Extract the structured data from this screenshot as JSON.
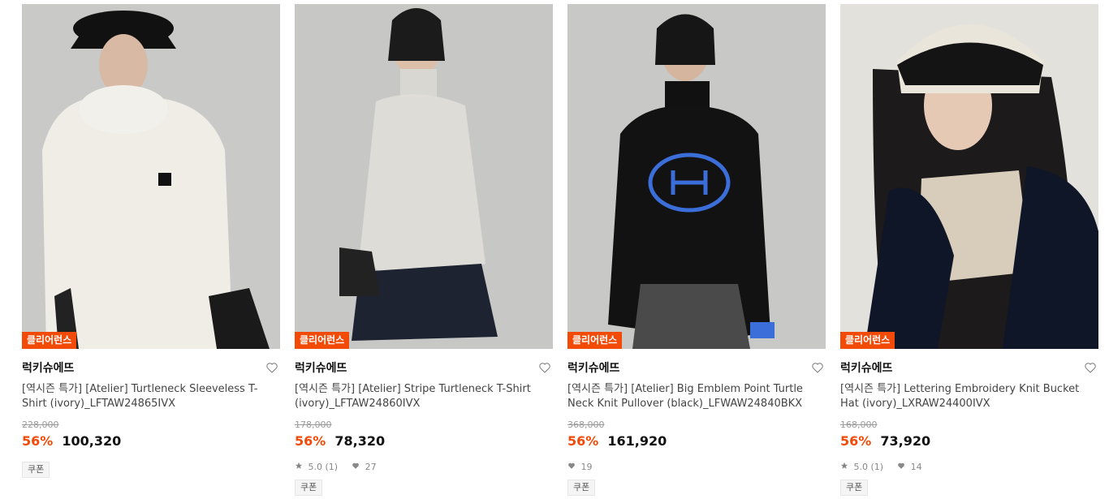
{
  "products": [
    {
      "tag": "클리어런스",
      "brand": "럭키슈에뜨",
      "title": "[역시즌 특가] [Atelier] Turtleneck Sleeveless T-Shirt (ivory)_LFTAW24865IVX",
      "original_price": "228,000",
      "discount_rate": "56%",
      "sale_price": "100,320",
      "rating": "",
      "likes": "",
      "coupon": "쿠폰"
    },
    {
      "tag": "클리어런스",
      "brand": "럭키슈에뜨",
      "title": "[역시즌 특가] [Atelier] Stripe Turtleneck T-Shirt (ivory)_LFTAW24860IVX",
      "original_price": "178,000",
      "discount_rate": "56%",
      "sale_price": "78,320",
      "rating": "5.0 (1)",
      "likes": "27",
      "coupon": "쿠폰"
    },
    {
      "tag": "클리어런스",
      "brand": "럭키슈에뜨",
      "title": "[역시즌 특가] [Atelier] Big Emblem Point Turtle Neck Knit Pullover (black)_LFWAW24840BKX",
      "original_price": "368,000",
      "discount_rate": "56%",
      "sale_price": "161,920",
      "rating": "",
      "likes": "19",
      "coupon": "쿠폰"
    },
    {
      "tag": "클리어런스",
      "brand": "럭키슈에뜨",
      "title": "[역시즌 특가] Lettering Embroidery Knit Bucket Hat (ivory)_LXRAW24400IVX",
      "original_price": "168,000",
      "discount_rate": "56%",
      "sale_price": "73,920",
      "rating": "5.0 (1)",
      "likes": "14",
      "coupon": "쿠폰"
    }
  ],
  "colors": {
    "accent": "#f24b08",
    "text": "#111111",
    "muted": "#9a9a9a"
  }
}
